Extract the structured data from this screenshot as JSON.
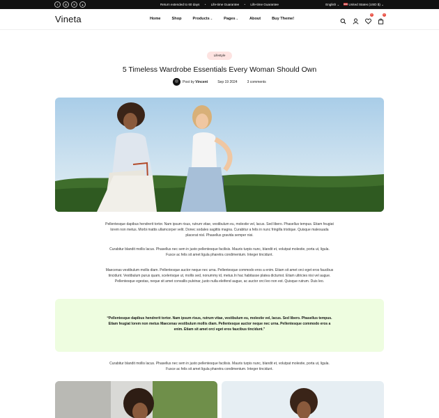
{
  "topbar": {
    "social_icons": [
      "facebook-icon",
      "instagram-icon",
      "x-icon",
      "snapchat-icon"
    ],
    "messages": [
      "Return extended to 60 days",
      "Life-time Guarantee",
      "Life-time Guarantee"
    ],
    "language": "English",
    "currency": "United States (USD $)"
  },
  "header": {
    "logo": "Vineta",
    "nav": [
      {
        "label": "Home",
        "has_dropdown": false
      },
      {
        "label": "Shop",
        "has_dropdown": false
      },
      {
        "label": "Products",
        "has_dropdown": true
      },
      {
        "label": "Pages",
        "has_dropdown": true
      },
      {
        "label": "About",
        "has_dropdown": false
      },
      {
        "label": "Buy Theme!",
        "has_dropdown": false
      }
    ],
    "icons": [
      "search-icon",
      "user-icon",
      "heart-icon",
      "cart-icon"
    ],
    "wishlist_count": "0",
    "cart_count": "0"
  },
  "article": {
    "tag": "Lifestyle",
    "title": "5 Timeless Wardrobe Essentials Every Woman Should Own",
    "author_prefix": "Post by",
    "author": "Vincent",
    "date": "Sep 19 2024",
    "comments": "3 comments",
    "paragraphs": [
      "Pellentesque dapibus hendrerit tortor. Nam ipsum risus, rutrum vitae, vestibulum eu, molestie vel, lacus. Sed libero. Phasellus tempus. Etiam feugiat lorem non metus. Morbi mattis ullamcorper velit. Donec sodales sagittis magna. Curabitur a felis in nunc fringilla tristique. Quisque malesuada placerat nisl. Phasellus gravida semper nisi.",
      "Curabitur blandit mollis lacus. Phasellus nec sem in justo pellentesque facilisis. Mauris turpis nunc, blandit et, volutpat molestie, porta ut, ligula. Fusce ac felis sit amet ligula pharetra condimentum. Integer tincidunt.",
      "Maecenas vestibulum mollis diam. Pellentesque auctor neque nec urna. Pellentesque commodo eros a enim. Etiam sit amet orci eget eros faucibus tincidunt. Vestibulum purus quam, scelerisque ut, mollis sed, nonummy id, metus.In hac habitasse platea dictumst. Etiam ultricies nisi vel augue. Pellentesque egestas, neque sit amet convallis pulvinar, justo nulla eleifend augue, ac auctor orci leo non est. Quisque rutrum. Duis leo.",
      "Curabitur blandit mollis lacus. Phasellus nec sem in justo pellentesque facilisis. Mauris turpis nunc, blandit et, volutpat molestie, porta ut, ligula. Fusce ac felis sit amet ligula pharetra condimentum. Integer tincidunt."
    ],
    "quote": "“Pellentesque dapibus hendrerit tortor. Nam ipsum risus, rutrum vitae, vestibulum eu, molestie vel, lacus. Sed libero. Phasellus tempus. Etiam feugiat lorem non metus Maecenas vestibulum mollis diam. Pellentesque auctor neque nec urna. Pellentesque commodo eros a enim. Etiam sit amet orci eget eros faucibus tincidunt.”"
  },
  "colors": {
    "topbar_bg": "#111111",
    "tag_bg": "#fde3e1",
    "quote_bg": "#eefde0",
    "badge": "#e8473a"
  }
}
